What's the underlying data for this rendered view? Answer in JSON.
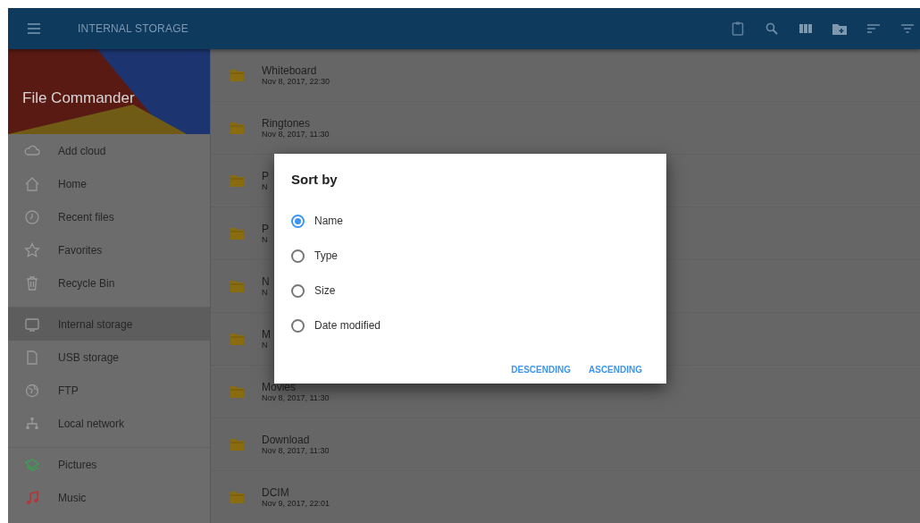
{
  "toolbar": {
    "title": "INTERNAL STORAGE"
  },
  "sidebar": {
    "app_title": "File Commander",
    "groups": [
      [
        {
          "label": "Add cloud",
          "selected": false
        },
        {
          "label": "Home",
          "selected": false
        },
        {
          "label": "Recent files",
          "selected": false
        },
        {
          "label": "Favorites",
          "selected": false
        },
        {
          "label": "Recycle Bin",
          "selected": false
        }
      ],
      [
        {
          "label": "Internal storage",
          "selected": true
        },
        {
          "label": "USB storage",
          "selected": false
        },
        {
          "label": "FTP",
          "selected": false
        },
        {
          "label": "Local network",
          "selected": false
        }
      ],
      [
        {
          "label": "Pictures",
          "selected": false
        },
        {
          "label": "Music",
          "selected": false
        }
      ]
    ]
  },
  "files": [
    {
      "name": "Whiteboard",
      "date": "Nov 8, 2017, 22:30"
    },
    {
      "name": "Ringtones",
      "date": "Nov 8, 2017, 11:30"
    },
    {
      "name": "P",
      "date": "N"
    },
    {
      "name": "P",
      "date": "N"
    },
    {
      "name": "N",
      "date": "N"
    },
    {
      "name": "M",
      "date": "N"
    },
    {
      "name": "Movies",
      "date": "Nov 8, 2017, 11:30"
    },
    {
      "name": "Download",
      "date": "Nov 8, 2017, 11:30"
    },
    {
      "name": "DCIM",
      "date": "Nov 9, 2017, 22:01"
    }
  ],
  "dialog": {
    "title": "Sort by",
    "options": [
      {
        "label": "Name",
        "selected": true
      },
      {
        "label": "Type",
        "selected": false
      },
      {
        "label": "Size",
        "selected": false
      },
      {
        "label": "Date modified",
        "selected": false
      }
    ],
    "buttons": [
      "DESCENDING",
      "ASCENDING"
    ]
  }
}
